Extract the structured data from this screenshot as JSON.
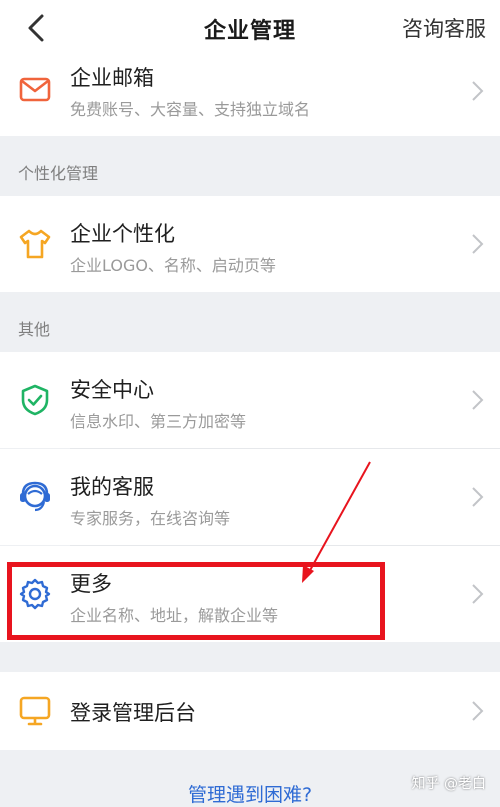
{
  "header": {
    "title": "企业管理",
    "action_label": "咨询客服"
  },
  "sections": {
    "personalization_label": "个性化管理",
    "other_label": "其他"
  },
  "items": {
    "mail": {
      "title": "企业邮箱",
      "subtitle": "免费账号、大容量、支持独立域名",
      "icon": "mail-icon"
    },
    "personalize": {
      "title": "企业个性化",
      "subtitle": "企业LOGO、名称、启动页等",
      "icon": "tshirt-icon"
    },
    "security": {
      "title": "安全中心",
      "subtitle": "信息水印、第三方加密等",
      "icon": "shield-check-icon"
    },
    "service": {
      "title": "我的客服",
      "subtitle": "专家服务，在线咨询等",
      "icon": "headset-icon"
    },
    "more": {
      "title": "更多",
      "subtitle": "企业名称、地址，解散企业等",
      "icon": "gear-icon"
    },
    "admin": {
      "title": "登录管理后台",
      "icon": "monitor-icon"
    }
  },
  "footer": {
    "help_link": "管理遇到困难?",
    "watermark": "知乎 @老白"
  },
  "colors": {
    "accent_blue": "#2f6bd4",
    "highlight_red": "#e8141e",
    "mail_orange": "#f0643c",
    "shirt_yellow": "#f5a623",
    "shield_green": "#1fb464",
    "monitor_orange": "#f5a623"
  }
}
